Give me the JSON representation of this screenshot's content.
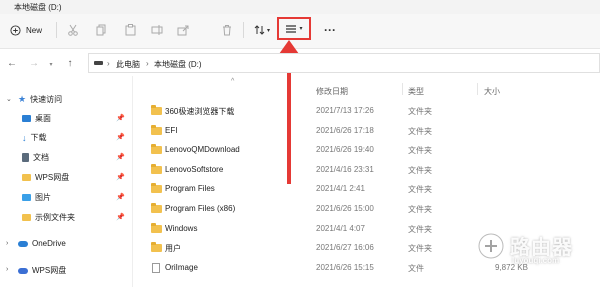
{
  "window": {
    "title": "本地磁盘 (D:)"
  },
  "toolbar": {
    "new_label": "New"
  },
  "address": {
    "crumbs": [
      "此电脑",
      "本地磁盘 (D:)"
    ]
  },
  "columns": {
    "date": "修改日期",
    "type": "类型",
    "size": "大小"
  },
  "sidebar": {
    "quick_access": "快速访问",
    "items": [
      "桌面",
      "下载",
      "文档",
      "WPS网盘",
      "图片",
      "示例文件夹"
    ],
    "onedrive": "OneDrive",
    "wps": "WPS网盘"
  },
  "files": [
    {
      "name": "360极速浏览器下载",
      "date": "2021/7/13 17:26",
      "type": "文件夹",
      "size": ""
    },
    {
      "name": "EFI",
      "date": "2021/6/26 17:18",
      "type": "文件夹",
      "size": ""
    },
    {
      "name": "LenovoQMDownload",
      "date": "2021/6/26 19:40",
      "type": "文件夹",
      "size": ""
    },
    {
      "name": "LenovoSoftstore",
      "date": "2021/4/16 23:31",
      "type": "文件夹",
      "size": ""
    },
    {
      "name": "Program Files",
      "date": "2021/4/1 2:41",
      "type": "文件夹",
      "size": ""
    },
    {
      "name": "Program Files (x86)",
      "date": "2021/6/26 15:00",
      "type": "文件夹",
      "size": ""
    },
    {
      "name": "Windows",
      "date": "2021/4/1 4:07",
      "type": "文件夹",
      "size": ""
    },
    {
      "name": "用户",
      "date": "2021/6/27 16:06",
      "type": "文件夹",
      "size": ""
    },
    {
      "name": "OriImage",
      "date": "2021/6/26 15:15",
      "type": "文件",
      "size": "9,872 KB"
    }
  ],
  "watermark": {
    "text": "路由器",
    "sub": "luyouqi.com"
  },
  "colors": {
    "highlight": "#e53935",
    "folder": "#f2c14e"
  }
}
